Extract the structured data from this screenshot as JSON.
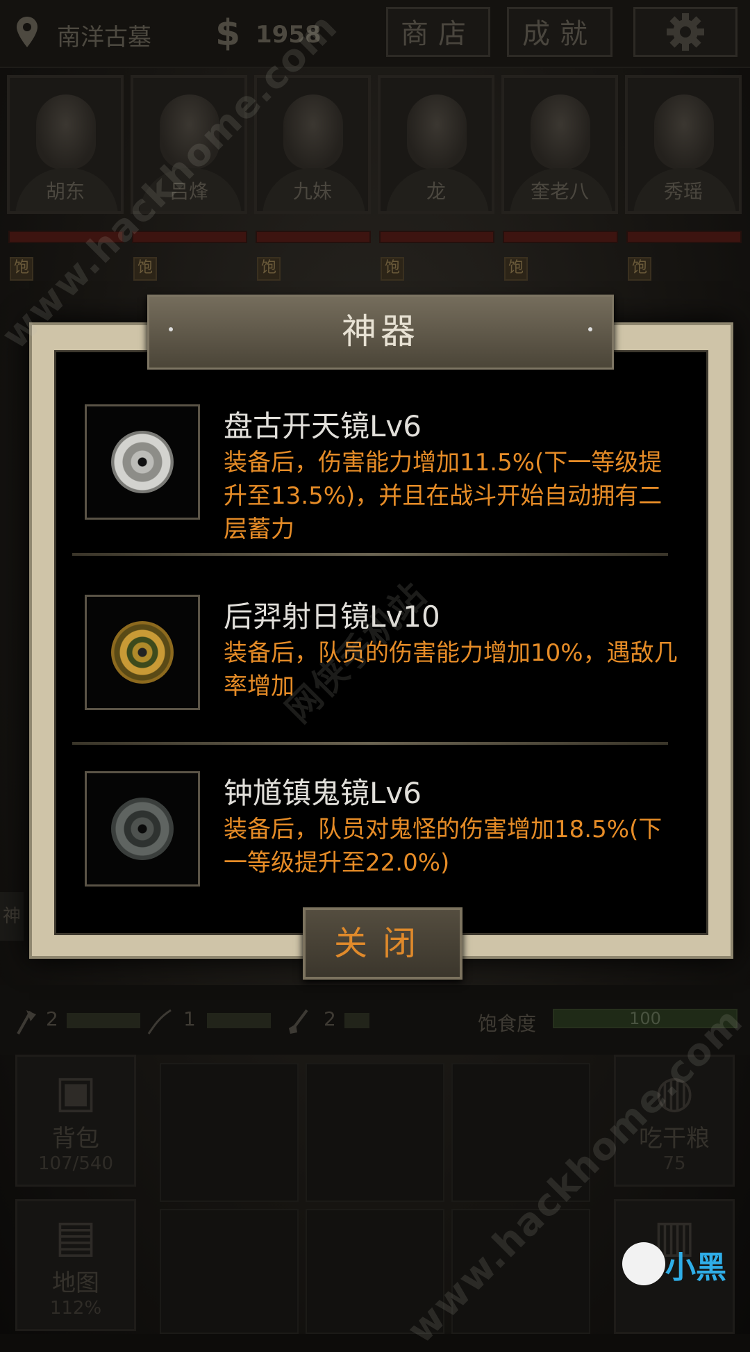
{
  "topbar": {
    "location": "南洋古墓",
    "money_symbol": "$",
    "money": "1958",
    "shop_label": "商店",
    "achievement_label": "成就",
    "location_icon": "map-pin-icon",
    "settings_icon": "gear-icon"
  },
  "characters": [
    {
      "name": "胡东",
      "status": "饱"
    },
    {
      "name": "吕烽",
      "status": "饱"
    },
    {
      "name": "九妹",
      "status": "饱"
    },
    {
      "name": "龙",
      "status": "饱"
    },
    {
      "name": "奎老八",
      "status": "饱"
    },
    {
      "name": "秀瑶",
      "status": "饱"
    }
  ],
  "modal": {
    "title": "神器",
    "items": [
      {
        "name": "盘古开天镜Lv6",
        "desc": "装备后，伤害能力增加11.5%(下一等级提升至13.5%)，并且在战斗开始自动拥有二层蓄力",
        "icon": "silver-mirror-icon"
      },
      {
        "name": "后羿射日镜Lv10",
        "desc": "装备后，队员的伤害能力增加10%，遇敌几率增加",
        "icon": "golden-mirror-icon"
      },
      {
        "name": "钟馗镇鬼镜Lv6",
        "desc": "装备后，队员对鬼怪的伤害增加18.5%(下一等级提升至22.0%)",
        "icon": "dark-mirror-icon"
      }
    ],
    "close_label": "关闭"
  },
  "stats": {
    "tools": [
      {
        "icon": "axe-icon",
        "count": "2"
      },
      {
        "icon": "rope-icon",
        "count": "1"
      },
      {
        "icon": "shovel-icon",
        "count": "2"
      }
    ],
    "satiety_label": "饱食度",
    "satiety_value": "100"
  },
  "bottom": {
    "bag_label": "背包",
    "bag_value": "107/540",
    "food_label": "吃干粮",
    "food_value": "75",
    "map_label": "地图",
    "map_value": "112%",
    "left_tab": "神"
  },
  "watermarks": {
    "top": "www.hackhome.com",
    "middle": "网侠手机站",
    "bottom": "www.hackhome.com",
    "logo": "小黑"
  },
  "colors": {
    "accent_orange": "#e68c27",
    "title_text": "#e1dfda",
    "hp_red": "#3d1410"
  }
}
